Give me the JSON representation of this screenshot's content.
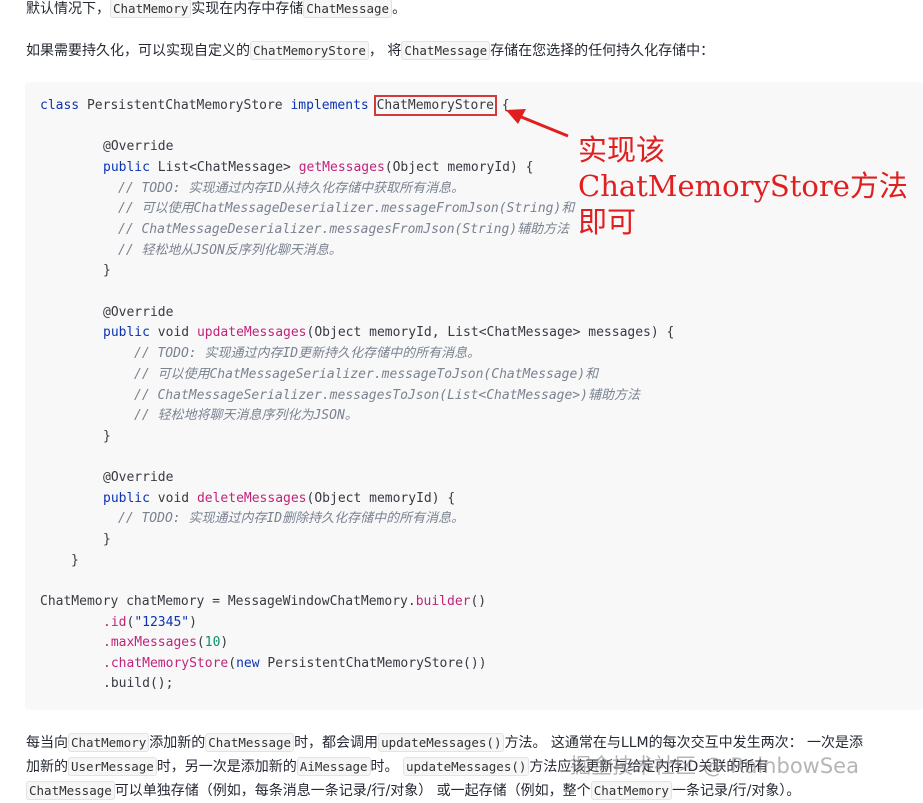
{
  "intro": {
    "p1_a": "默认情况下，",
    "p1_code1": "ChatMemory",
    "p1_b": "实现在内存中存储",
    "p1_code2": "ChatMessage",
    "p1_c": "。",
    "p2_a": "如果需要持久化，可以实现自定义的",
    "p2_code1": "ChatMemoryStore",
    "p2_b": "， 将",
    "p2_code2": "ChatMessage",
    "p2_c": "存储在您选择的任何持久化存储中："
  },
  "code": {
    "l1_a": "class",
    "l1_b": " PersistentChatMemoryStore ",
    "l1_c": "implements",
    "l1_d": "ChatMemoryStore",
    "l1_e": " {",
    "override": "@Override",
    "get_sig_a": "public",
    "get_sig_b": " List<ChatMessage> ",
    "get_sig_c": "getMessages",
    "get_sig_d": "(Object memoryId) {",
    "get_c1": "// TODO: 实现通过内存ID从持久化存储中获取所有消息。",
    "get_c2": "// 可以使用ChatMessageDeserializer.messageFromJson(String)和",
    "get_c3": "// ChatMessageDeserializer.messagesFromJson(String)辅助方法",
    "get_c4": "// 轻松地从JSON反序列化聊天消息。",
    "close": "}",
    "upd_sig_a": "public",
    "upd_sig_b": " void ",
    "upd_sig_c": "updateMessages",
    "upd_sig_d": "(Object memoryId, List<ChatMessage> messages) {",
    "upd_c1": "// TODO: 实现通过内存ID更新持久化存储中的所有消息。",
    "upd_c2": "// 可以使用ChatMessageSerializer.messageToJson(ChatMessage)和",
    "upd_c3": "// ChatMessageSerializer.messagesToJson(List<ChatMessage>)辅助方法",
    "upd_c4": "// 轻松地将聊天消息序列化为JSON。",
    "del_sig_a": "public",
    "del_sig_b": " void ",
    "del_sig_c": "deleteMessages",
    "del_sig_d": "(Object memoryId) {",
    "del_c1": "// TODO: 实现通过内存ID删除持久化存储中的所有消息。",
    "b1": "ChatMemory chatMemory = MessageWindowChatMemory.",
    "b1_fn": "builder",
    "b1_end": "()",
    "b2_fn": ".id",
    "b2_a": "(",
    "b2_str": "\"12345\"",
    "b2_b": ")",
    "b3_fn": ".maxMessages",
    "b3_a": "(",
    "b3_num": "10",
    "b3_b": ")",
    "b4_fn": ".chatMemoryStore",
    "b4_a": "(",
    "b4_kw": "new",
    "b4_b": " PersistentChatMemoryStore())",
    "b5": ".build();"
  },
  "annotation": {
    "text": "实现该\nChatMemoryStore方法\n即可",
    "color": "#e02020"
  },
  "outro": {
    "l1_a": "每当向",
    "l1_code1": "ChatMemory",
    "l1_b": "添加新的",
    "l1_code2": "ChatMessage",
    "l1_c": "时，都会调用",
    "l1_code3": "updateMessages()",
    "l1_d": "方法。 这通常在与LLM的每次交互中发生两次： 一次是添",
    "l2_a": "加新的",
    "l2_code1": "UserMessage",
    "l2_b": "时，另一次是添加新的",
    "l2_code2": "AiMessage",
    "l2_c": "时。 ",
    "l2_code3": "updateMessages()",
    "l2_d": "方法应该更新与给定内存ID关联的所有",
    "l3_code1": "ChatMessage",
    "l3_a": "可以单独存储（例如，每条消息一条记录/行/对象） 或一起存储（例如，整个",
    "l3_code2": "ChatMemory",
    "l3_b": "一条记录/行/对象）。"
  },
  "watermark": "掘金技术社区 @ RainbowSea"
}
